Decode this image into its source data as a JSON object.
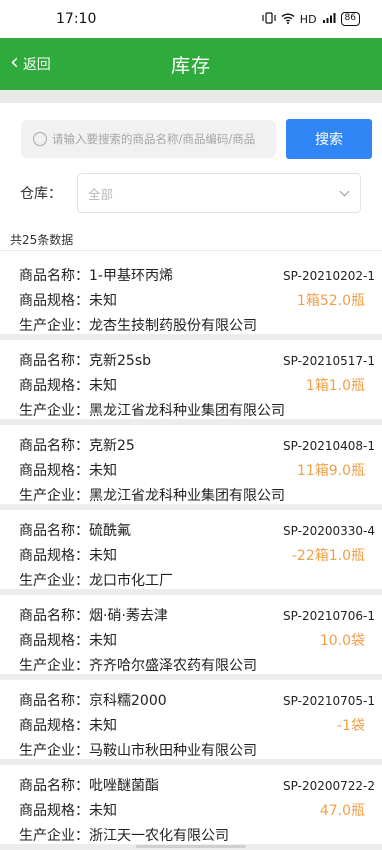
{
  "status_bar": {
    "time": "17:10",
    "signal_text": "HD",
    "battery": "86"
  },
  "nav": {
    "back_label": "返回",
    "title": "库存"
  },
  "search": {
    "placeholder": "请输入要搜索的商品名称/商品编码/商品",
    "button_label": "搜索"
  },
  "warehouse": {
    "label": "仓库：",
    "value": "全部"
  },
  "count_text": "共25条数据",
  "items": [
    {
      "name_line": "商品名称：1-甲基环丙烯",
      "spec_line": "商品规格：未知",
      "maker_line": "生产企业：龙杏生技制药股份有限公司",
      "code": "SP-20210202-1",
      "qty": "1箱52.0瓶"
    },
    {
      "name_line": "商品名称：克新25sb",
      "spec_line": "商品规格：未知",
      "maker_line": "生产企业：黑龙江省龙科种业集团有限公司",
      "code": "SP-20210517-1",
      "qty": "1箱1.0瓶"
    },
    {
      "name_line": "商品名称：克新25",
      "spec_line": "商品规格：未知",
      "maker_line": "生产企业：黑龙江省龙科种业集团有限公司",
      "code": "SP-20210408-1",
      "qty": "11箱9.0瓶"
    },
    {
      "name_line": "商品名称：硫酰氟",
      "spec_line": "商品规格：未知",
      "maker_line": "生产企业：龙口市化工厂",
      "code": "SP-20200330-4",
      "qty": "-22箱1.0瓶"
    },
    {
      "name_line": "商品名称：烟·硝·莠去津",
      "spec_line": "商品规格：未知",
      "maker_line": "生产企业：齐齐哈尔盛泽农药有限公司",
      "code": "SP-20210706-1",
      "qty": "10.0袋"
    },
    {
      "name_line": "商品名称：京科糯2000",
      "spec_line": "商品规格：未知",
      "maker_line": "生产企业：马鞍山市秋田种业有限公司",
      "code": "SP-20210705-1",
      "qty": "-1袋"
    },
    {
      "name_line": "商品名称：吡唑醚菌酯",
      "spec_line": "商品规格：未知",
      "maker_line": "生产企业：浙江天一农化有限公司",
      "code": "SP-20200722-2",
      "qty": "47.0瓶"
    }
  ],
  "colors": {
    "nav_green": "#2faa3c",
    "search_blue": "#2f86f4",
    "qty_orange": "#f0a048"
  }
}
